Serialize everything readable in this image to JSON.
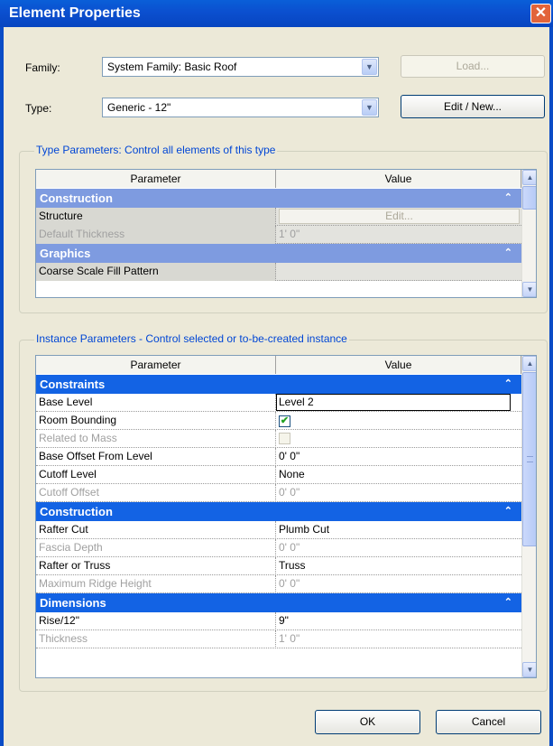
{
  "window": {
    "title": "Element Properties",
    "close_glyph": "✕"
  },
  "family": {
    "label": "Family:",
    "value": "System Family: Basic Roof"
  },
  "type": {
    "label": "Type:",
    "value": "Generic - 12\""
  },
  "buttons": {
    "load": "Load...",
    "edit_new": "Edit / New...",
    "ok": "OK",
    "cancel": "Cancel"
  },
  "type_params": {
    "title": "Type Parameters: Control all elements of this type",
    "col_param": "Parameter",
    "col_value": "Value",
    "groups": [
      {
        "name": "Construction",
        "rows": [
          {
            "param": "Structure",
            "value": "Edit...",
            "kind": "edit-button"
          },
          {
            "param": "Default Thickness",
            "value": "1'  0\"",
            "disabled": true
          }
        ]
      },
      {
        "name": "Graphics",
        "rows": [
          {
            "param": "Coarse Scale Fill Pattern",
            "value": ""
          }
        ]
      }
    ]
  },
  "instance_params": {
    "title": "Instance Parameters - Control selected or to-be-created instance",
    "col_param": "Parameter",
    "col_value": "Value",
    "groups": [
      {
        "name": "Constraints",
        "rows": [
          {
            "param": "Base Level",
            "value": "Level 2",
            "kind": "editbox"
          },
          {
            "param": "Room Bounding",
            "value": "",
            "kind": "checkbox",
            "checked": true
          },
          {
            "param": "Related to Mass",
            "value": "",
            "kind": "checkbox",
            "checked": false,
            "disabled": true
          },
          {
            "param": "Base Offset From Level",
            "value": "0'  0\""
          },
          {
            "param": "Cutoff Level",
            "value": "None"
          },
          {
            "param": "Cutoff Offset",
            "value": "0'  0\"",
            "disabled": true
          }
        ]
      },
      {
        "name": "Construction",
        "rows": [
          {
            "param": "Rafter Cut",
            "value": "Plumb Cut"
          },
          {
            "param": "Fascia Depth",
            "value": "0'  0\"",
            "disabled": true
          },
          {
            "param": "Rafter or Truss",
            "value": "Truss"
          },
          {
            "param": "Maximum Ridge Height",
            "value": "0'  0\"",
            "disabled": true
          }
        ]
      },
      {
        "name": "Dimensions",
        "rows": [
          {
            "param": "Rise/12\"",
            "value": "9\""
          },
          {
            "param": "Thickness",
            "value": "1'  0\"",
            "disabled": true
          }
        ]
      }
    ]
  },
  "icons": {
    "collapse": "chevron-double-up-icon",
    "dropdown": "chevron-down-icon",
    "check": "check-icon"
  }
}
